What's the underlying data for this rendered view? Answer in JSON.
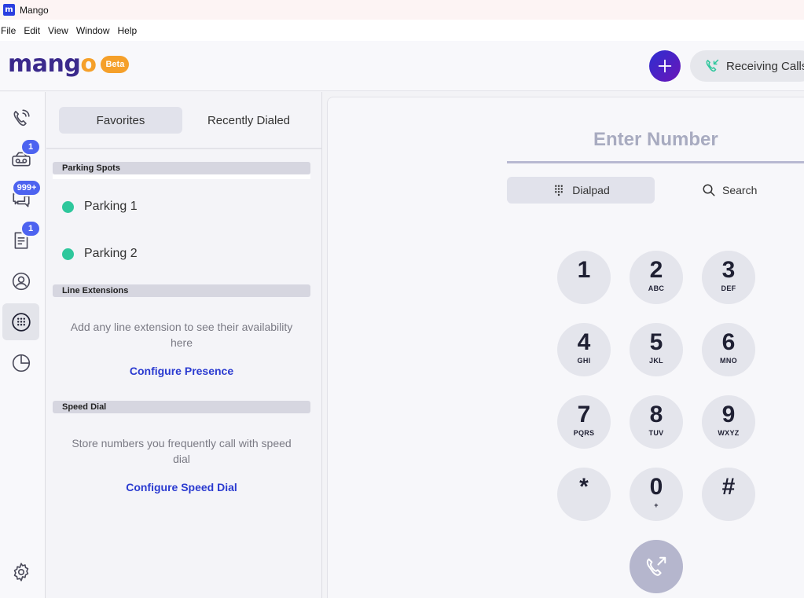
{
  "window": {
    "title": "Mango",
    "app_icon": "m"
  },
  "menu": [
    "File",
    "Edit",
    "View",
    "Window",
    "Help"
  ],
  "header": {
    "logo_prefix": "mang",
    "logo_o": "o",
    "beta_label": "Beta",
    "receiving_label": "Receiving Calls"
  },
  "rail": {
    "badges": {
      "voicemail": "1",
      "messages": "999+",
      "notes": "1"
    },
    "icons": [
      "phone-icon",
      "voicemail-icon",
      "messages-icon",
      "notes-icon",
      "contacts-icon",
      "dialpad-icon",
      "reports-icon",
      "settings-icon"
    ]
  },
  "panel": {
    "tabs": [
      "Favorites",
      "Recently Dialed"
    ],
    "parking_header": "Parking Spots",
    "parking": [
      "Parking 1",
      "Parking 2"
    ],
    "line_header": "Line Extensions",
    "line_hint": "Add any line extension to see their availability here",
    "line_cta": "Configure Presence",
    "speed_header": "Speed Dial",
    "speed_hint": "Store numbers you frequently call with speed dial",
    "speed_cta": "Configure Speed Dial"
  },
  "dialer": {
    "placeholder": "Enter Number",
    "modes": [
      "Dialpad",
      "Search"
    ],
    "keys": [
      {
        "d": "1",
        "l": ""
      },
      {
        "d": "2",
        "l": "ABC"
      },
      {
        "d": "3",
        "l": "DEF"
      },
      {
        "d": "4",
        "l": "GHI"
      },
      {
        "d": "5",
        "l": "JKL"
      },
      {
        "d": "6",
        "l": "MNO"
      },
      {
        "d": "7",
        "l": "PQRS"
      },
      {
        "d": "8",
        "l": "TUV"
      },
      {
        "d": "9",
        "l": "WXYZ"
      },
      {
        "d": "*",
        "l": ""
      },
      {
        "d": "0",
        "l": "+"
      },
      {
        "d": "#",
        "l": ""
      }
    ]
  },
  "colors": {
    "brand": "#3b2a8c",
    "accent": "#f5a02a",
    "badge": "#4d63f0",
    "link": "#2a3ad0",
    "online": "#2ec79c"
  }
}
